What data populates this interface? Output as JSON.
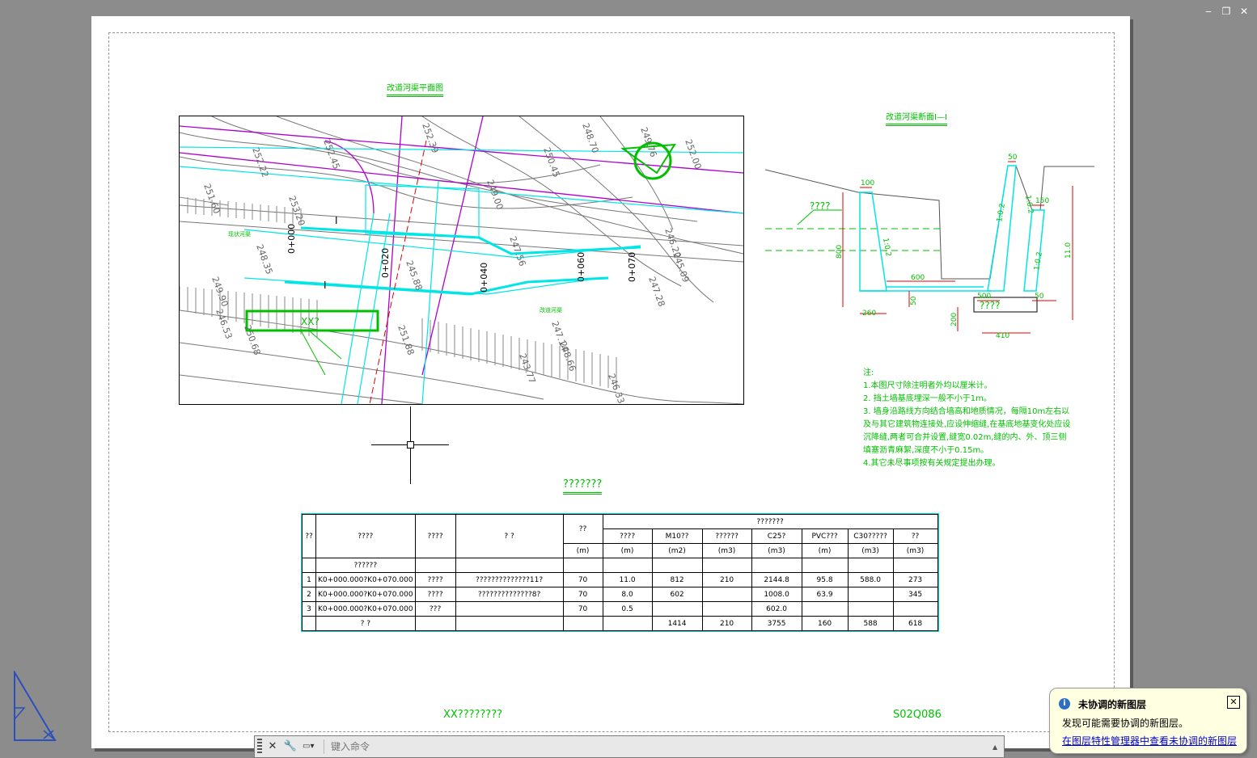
{
  "window_controls": {
    "minimize": "‒",
    "restore": "❐",
    "close": "✕"
  },
  "drawing": {
    "plan_title": "改道河渠平面图",
    "section_title": "改道河渠断面Ⅰ—Ⅰ",
    "table_title": "???????",
    "footer_left": "XX????????",
    "footer_right": "S02Q086",
    "plan_labels": {
      "chainage": [
        "0+000",
        "0+020",
        "0+040",
        "0+060",
        "0+070"
      ],
      "xx_label": "XX?",
      "existing_channel": "现状河渠",
      "diverted_channel": "改道河渠",
      "cut_marks": [
        "I",
        "I"
      ],
      "contours": [
        "251.60",
        "252.22",
        "252.45",
        "253.20",
        "252.39",
        "248.70",
        "249.76",
        "250.45",
        "252.00",
        "249.00",
        "248.35",
        "247.56",
        "246.20",
        "245.09",
        "247.28",
        "246.53",
        "247.14",
        "245.88",
        "248.66",
        "243.77",
        "246.33",
        "251.88",
        "250.68",
        "249.90"
      ]
    },
    "section_labels": {
      "dims": [
        "100",
        "50",
        "150",
        "800",
        "600",
        "11.0",
        "260",
        "50",
        "200",
        "500",
        "50",
        "410"
      ],
      "slopes": [
        "1:0.2",
        "1:0.2",
        "1:0.2",
        "1:0.2"
      ],
      "tag1": "????",
      "tag2": "????"
    },
    "notes": {
      "heading": "注:",
      "lines": [
        "1.本图尺寸除注明者外均以厘米计。",
        "2. 挡土墙基底埋深一般不小于1m。",
        "3. 墙身沿路线方向结合墙高和地质情况，每隔10m左右以及与其它建筑物连接处,应设伸缩缝,在基底地基变化处应设沉降缝,两者可合并设置,缝宽0.02m,缝的内、外、顶三侧填塞沥青麻絮,深度不小于0.15m。",
        "4.其它未尽事项按有关规定提出办理。"
      ]
    },
    "table": {
      "header_group": "???????",
      "headers": [
        "??",
        "????",
        "????",
        "?  ?",
        "??",
        "????",
        "M10??",
        "??????",
        "C25?",
        "PVC???",
        "C30?????",
        "??"
      ],
      "units": [
        "(m)",
        "(m)",
        "(m2)",
        "(m3)",
        "(m3)",
        "(m)",
        "(m3)",
        "(m3)"
      ],
      "section_row": "??????",
      "rows": [
        [
          "1",
          "K0+000.000?K0+070.000",
          "????",
          "??????????????11?",
          "70",
          "11.0",
          "812",
          "210",
          "2144.8",
          "95.8",
          "588.0",
          "273"
        ],
        [
          "2",
          "K0+000.000?K0+070.000",
          "????",
          "??????????????8?",
          "70",
          "8.0",
          "602",
          "",
          "1008.0",
          "63.9",
          "",
          "345"
        ],
        [
          "3",
          "K0+000.000?K0+070.000",
          "???",
          "",
          "70",
          "0.5",
          "",
          "",
          "602.0",
          "",
          "",
          ""
        ]
      ],
      "total_row": [
        "",
        "?  ?",
        "",
        "",
        "",
        "",
        "1414",
        "210",
        "3755",
        "160",
        "588",
        "618"
      ]
    }
  },
  "command_line": {
    "close_icon": "✕",
    "settings_icon": "🔧",
    "prompt_icon": "▭▾",
    "placeholder": "键入命令",
    "scroll_icon": "▲"
  },
  "notification": {
    "icon": "i",
    "title": "未协调的新图层",
    "body": "发现可能需要协调的新图层。",
    "link": "在图层特性管理器中查看未协调的新图层",
    "close": "✕"
  },
  "colors": {
    "cad_green": "#00c000",
    "cyan": "#00e5e5",
    "magenta": "#b000d0",
    "grey_contour": "#777777",
    "notification_bg": "#ffffe1",
    "background": "#8c8c8c"
  }
}
